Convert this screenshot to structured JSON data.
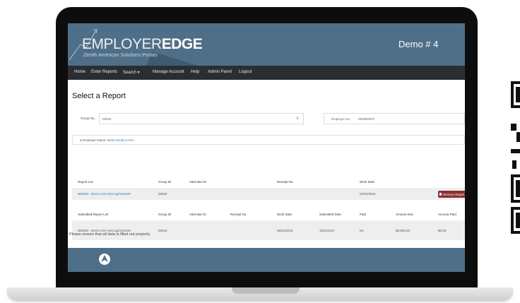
{
  "header": {
    "logo_main": "EMPLOYER",
    "logo_bold": "EDGE",
    "logo_sub": "Zenith American Solutions Portals",
    "demo": "Demo # 4"
  },
  "nav": {
    "items": [
      "Home",
      "Enter Reports",
      "Search ▾",
      "Manage Account",
      "Help",
      "Admin Panel",
      "Logout"
    ]
  },
  "page": {
    "title": "Select a Report"
  },
  "filters": {
    "group_label": "Group No.",
    "group_value": "DEM4",
    "employer_label": "Employer No.",
    "employer_value": "DEMEMPS"
  },
  "info": {
    "prefix": "Employer Name:",
    "employer": "Demo Empl 5 ACH"
  },
  "report_list": {
    "headers": [
      "Report List",
      "Group ID",
      "Alternate ID",
      "Receipt No.",
      "Work Date"
    ],
    "row": {
      "name": "DEM20 - Demo ACH test Agd Dem20",
      "group_id": "DEM4",
      "work_date": "04/01/2021",
      "button": "Remove Report"
    }
  },
  "submitted": {
    "headers": [
      "Submitted Report List",
      "Group ID",
      "Alternate ID",
      "Receipt No.",
      "Work Date",
      "Submitted Date",
      "Paid",
      "Amount Due",
      "Amount Paid"
    ],
    "row": {
      "name": "DEM20 - Demo ACH test Agd Dem20",
      "group_id": "DEM4",
      "work_date": "05/31/2018",
      "submitted_date": "10/11/2017",
      "paid": "No",
      "amount_due": "$8,805.25",
      "amount_paid": "$0.00"
    }
  },
  "footer_note": "Please ensure that all data is filled out properly."
}
